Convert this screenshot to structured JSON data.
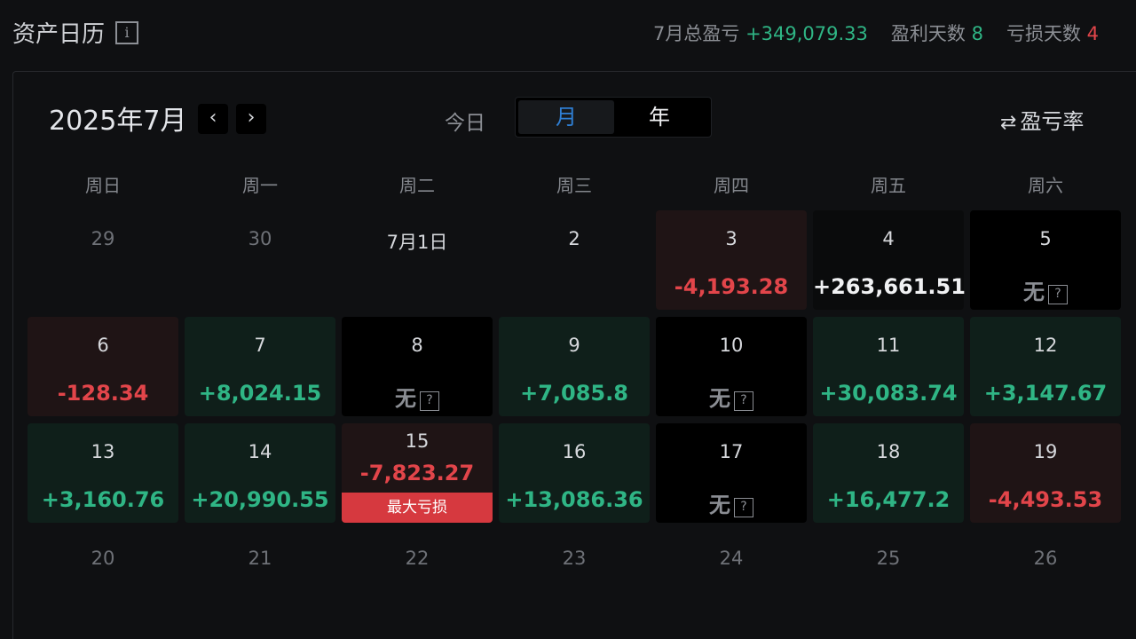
{
  "header": {
    "title": "资产日历",
    "info_icon": "i",
    "summary": {
      "total_label": "7月总盈亏",
      "total_value": "+349,079.33",
      "profit_days_label": "盈利天数",
      "profit_days_value": "8",
      "loss_days_label": "亏损天数",
      "loss_days_value": "4"
    }
  },
  "calendar": {
    "month_label": "2025年7月",
    "prev_label": "‹",
    "next_label": "›",
    "today_label": "今日",
    "view_options": [
      "月",
      "年"
    ],
    "active_view": "月",
    "rate_label": "盈亏率",
    "rate_icon": "⇄",
    "weekdays": [
      "周日",
      "周一",
      "周二",
      "周三",
      "周四",
      "周五",
      "周六"
    ],
    "none_label": "无",
    "none_icon": "?",
    "max_loss_label": "最大亏损",
    "rows": [
      [
        {
          "day": "29",
          "kind": "dim"
        },
        {
          "day": "30",
          "kind": "dim"
        },
        {
          "day": "7月1日",
          "kind": "plain"
        },
        {
          "day": "2",
          "kind": "plain"
        },
        {
          "day": "3",
          "kind": "loss",
          "value": "-4,193.28"
        },
        {
          "day": "4",
          "kind": "big",
          "value": "+263,661.51"
        },
        {
          "day": "5",
          "kind": "none"
        }
      ],
      [
        {
          "day": "6",
          "kind": "loss",
          "value": "-128.34"
        },
        {
          "day": "7",
          "kind": "gain",
          "value": "+8,024.15"
        },
        {
          "day": "8",
          "kind": "none"
        },
        {
          "day": "9",
          "kind": "gain",
          "value": "+7,085.8"
        },
        {
          "day": "10",
          "kind": "none"
        },
        {
          "day": "11",
          "kind": "gain",
          "value": "+30,083.74"
        },
        {
          "day": "12",
          "kind": "gain",
          "value": "+3,147.67"
        }
      ],
      [
        {
          "day": "13",
          "kind": "gain",
          "value": "+3,160.76"
        },
        {
          "day": "14",
          "kind": "gain",
          "value": "+20,990.55"
        },
        {
          "day": "15",
          "kind": "maxloss",
          "value": "-7,823.27"
        },
        {
          "day": "16",
          "kind": "gain",
          "value": "+13,086.36"
        },
        {
          "day": "17",
          "kind": "none"
        },
        {
          "day": "18",
          "kind": "gain",
          "value": "+16,477.2"
        },
        {
          "day": "19",
          "kind": "loss",
          "value": "-4,493.53"
        }
      ],
      [
        {
          "day": "20",
          "kind": "dim"
        },
        {
          "day": "21",
          "kind": "dim"
        },
        {
          "day": "22",
          "kind": "dim"
        },
        {
          "day": "23",
          "kind": "dim"
        },
        {
          "day": "24",
          "kind": "dim"
        },
        {
          "day": "25",
          "kind": "dim"
        },
        {
          "day": "26",
          "kind": "dim"
        }
      ]
    ]
  },
  "colors": {
    "positive": "#2fb585",
    "negative": "#e2454a",
    "accent": "#2f7fd4"
  }
}
